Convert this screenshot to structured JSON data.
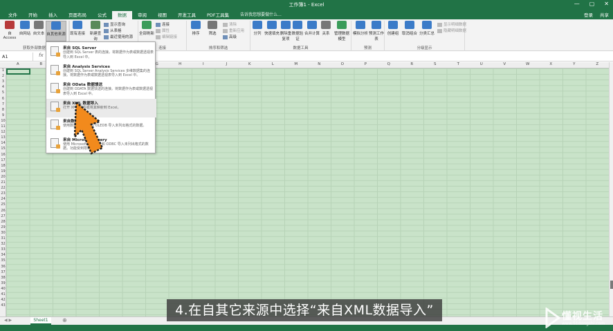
{
  "window": {
    "title": "工作簿1 - Excel",
    "buttons": [
      "—",
      "▢",
      "✕"
    ]
  },
  "tabs": {
    "items": [
      "文件",
      "开始",
      "插入",
      "页面布局",
      "公式",
      "数据",
      "审阅",
      "视图",
      "开发工具",
      "PDF工具集"
    ],
    "active_index": 5,
    "tell_me": "告诉我您想要做什么...",
    "account": "登录",
    "share": "共享"
  },
  "ribbon": {
    "buttons": [
      {
        "label": "自 Access",
        "icon": "access-icon"
      },
      {
        "label": "自网站",
        "icon": "web-icon"
      },
      {
        "label": "自文本",
        "icon": "text-file-icon"
      },
      {
        "label": "自其他来源",
        "icon": "other-source-icon"
      },
      {
        "label": "现有连接",
        "icon": "connection-icon"
      },
      {
        "label": "新建查询",
        "icon": "new-query-icon"
      },
      {
        "label": "全部刷新",
        "icon": "refresh-icon"
      },
      {
        "label": "排序",
        "icon": "sort-icon"
      },
      {
        "label": "筛选",
        "icon": "filter-icon"
      },
      {
        "label": "分列",
        "icon": "split-column-icon"
      },
      {
        "label": "快速填充",
        "icon": "flash-fill-icon"
      },
      {
        "label": "删除重复项",
        "icon": "remove-duplicates-icon"
      },
      {
        "label": "数据验证",
        "icon": "data-validation-icon"
      },
      {
        "label": "合并计算",
        "icon": "consolidate-icon"
      },
      {
        "label": "关系",
        "icon": "relationships-icon"
      },
      {
        "label": "管理数据模型",
        "icon": "data-model-icon"
      },
      {
        "label": "模拟分析",
        "icon": "what-if-icon"
      },
      {
        "label": "预测工作表",
        "icon": "forecast-icon"
      },
      {
        "label": "创建组",
        "icon": "group-icon"
      },
      {
        "label": "取消组合",
        "icon": "ungroup-icon"
      },
      {
        "label": "分类汇总",
        "icon": "subtotal-icon"
      }
    ],
    "small": {
      "show_query": "显示查询",
      "from_table": "从表格",
      "recent_sources": "最近使用的源",
      "connections": "连接",
      "properties": "属性",
      "edit_links": "编辑链接",
      "clear": "清除",
      "reapply": "重新应用",
      "advanced": "高级",
      "show_detail": "显示明细数据",
      "hide_detail": "隐藏明细数据"
    },
    "groups": {
      "get_external": "获取外部数据",
      "connections": "连接",
      "sort_filter": "排序和筛选",
      "data_tools": "数据工具",
      "forecast": "预测",
      "outline": "分级显示"
    }
  },
  "formula_bar": {
    "name_box": "A1",
    "fx": "fx"
  },
  "dropdown": {
    "items": [
      {
        "title": "来自 SQL Server",
        "desc": "创建到 SQL Server 表的连接。将数据作为表或数据透视表导入到 Excel 中。"
      },
      {
        "title": "来自 Analysis Services",
        "desc": "创建到 SQL Server Analysis Services 多维数据集的连接。将数据作为表或数据透视表导入到 Excel 中。"
      },
      {
        "title": "来自 OData 数据馈送",
        "desc": "创建到 ODATA 数据馈送的连接。将数据作为表或数据透视表导入到 Excel 中。"
      },
      {
        "title": "来自 XML 数据导入",
        "desc": "打开 XML 文件或将其映射到 Excel。"
      },
      {
        "title": "来自数据连接向导",
        "desc": "使用数据连接向导和 OLEDB 导入未列出格式的数据。"
      },
      {
        "title": "来自 Microsoft Query",
        "desc": "使用 Microsoft 查询向导和 ODBC 导入未列出格式的数据。功能受到限制。"
      }
    ]
  },
  "sheet": {
    "columns": [
      "A",
      "B",
      "C",
      "D",
      "E",
      "F",
      "G",
      "H",
      "I",
      "J",
      "K",
      "L",
      "M",
      "N",
      "O",
      "P",
      "Q",
      "R",
      "S",
      "T",
      "U",
      "V",
      "W",
      "X",
      "Y",
      "Z"
    ],
    "rows": [
      "1",
      "2",
      "3",
      "4",
      "5",
      "6",
      "7",
      "8",
      "9",
      "10",
      "11",
      "12",
      "13",
      "14",
      "15",
      "16",
      "17",
      "18",
      "19",
      "20",
      "21",
      "22",
      "23",
      "24",
      "25",
      "26",
      "27",
      "28",
      "29",
      "30",
      "31",
      "32",
      "33",
      "34",
      "35",
      "36",
      "37",
      "38",
      "39",
      "40",
      "41",
      "42",
      "43"
    ],
    "tab_name": "Sheet1",
    "add_sheet": "⊕",
    "nav": "◀ ▶"
  },
  "caption": "4.在自其它来源中选择“来自XML数据导入”",
  "watermark": {
    "text": "懂视生活",
    "sub": "www.51dongshi.com"
  },
  "colors": {
    "excel_green": "#217346",
    "sheet_bg": "#c9e3c9",
    "arrow": "#f28a1c"
  }
}
